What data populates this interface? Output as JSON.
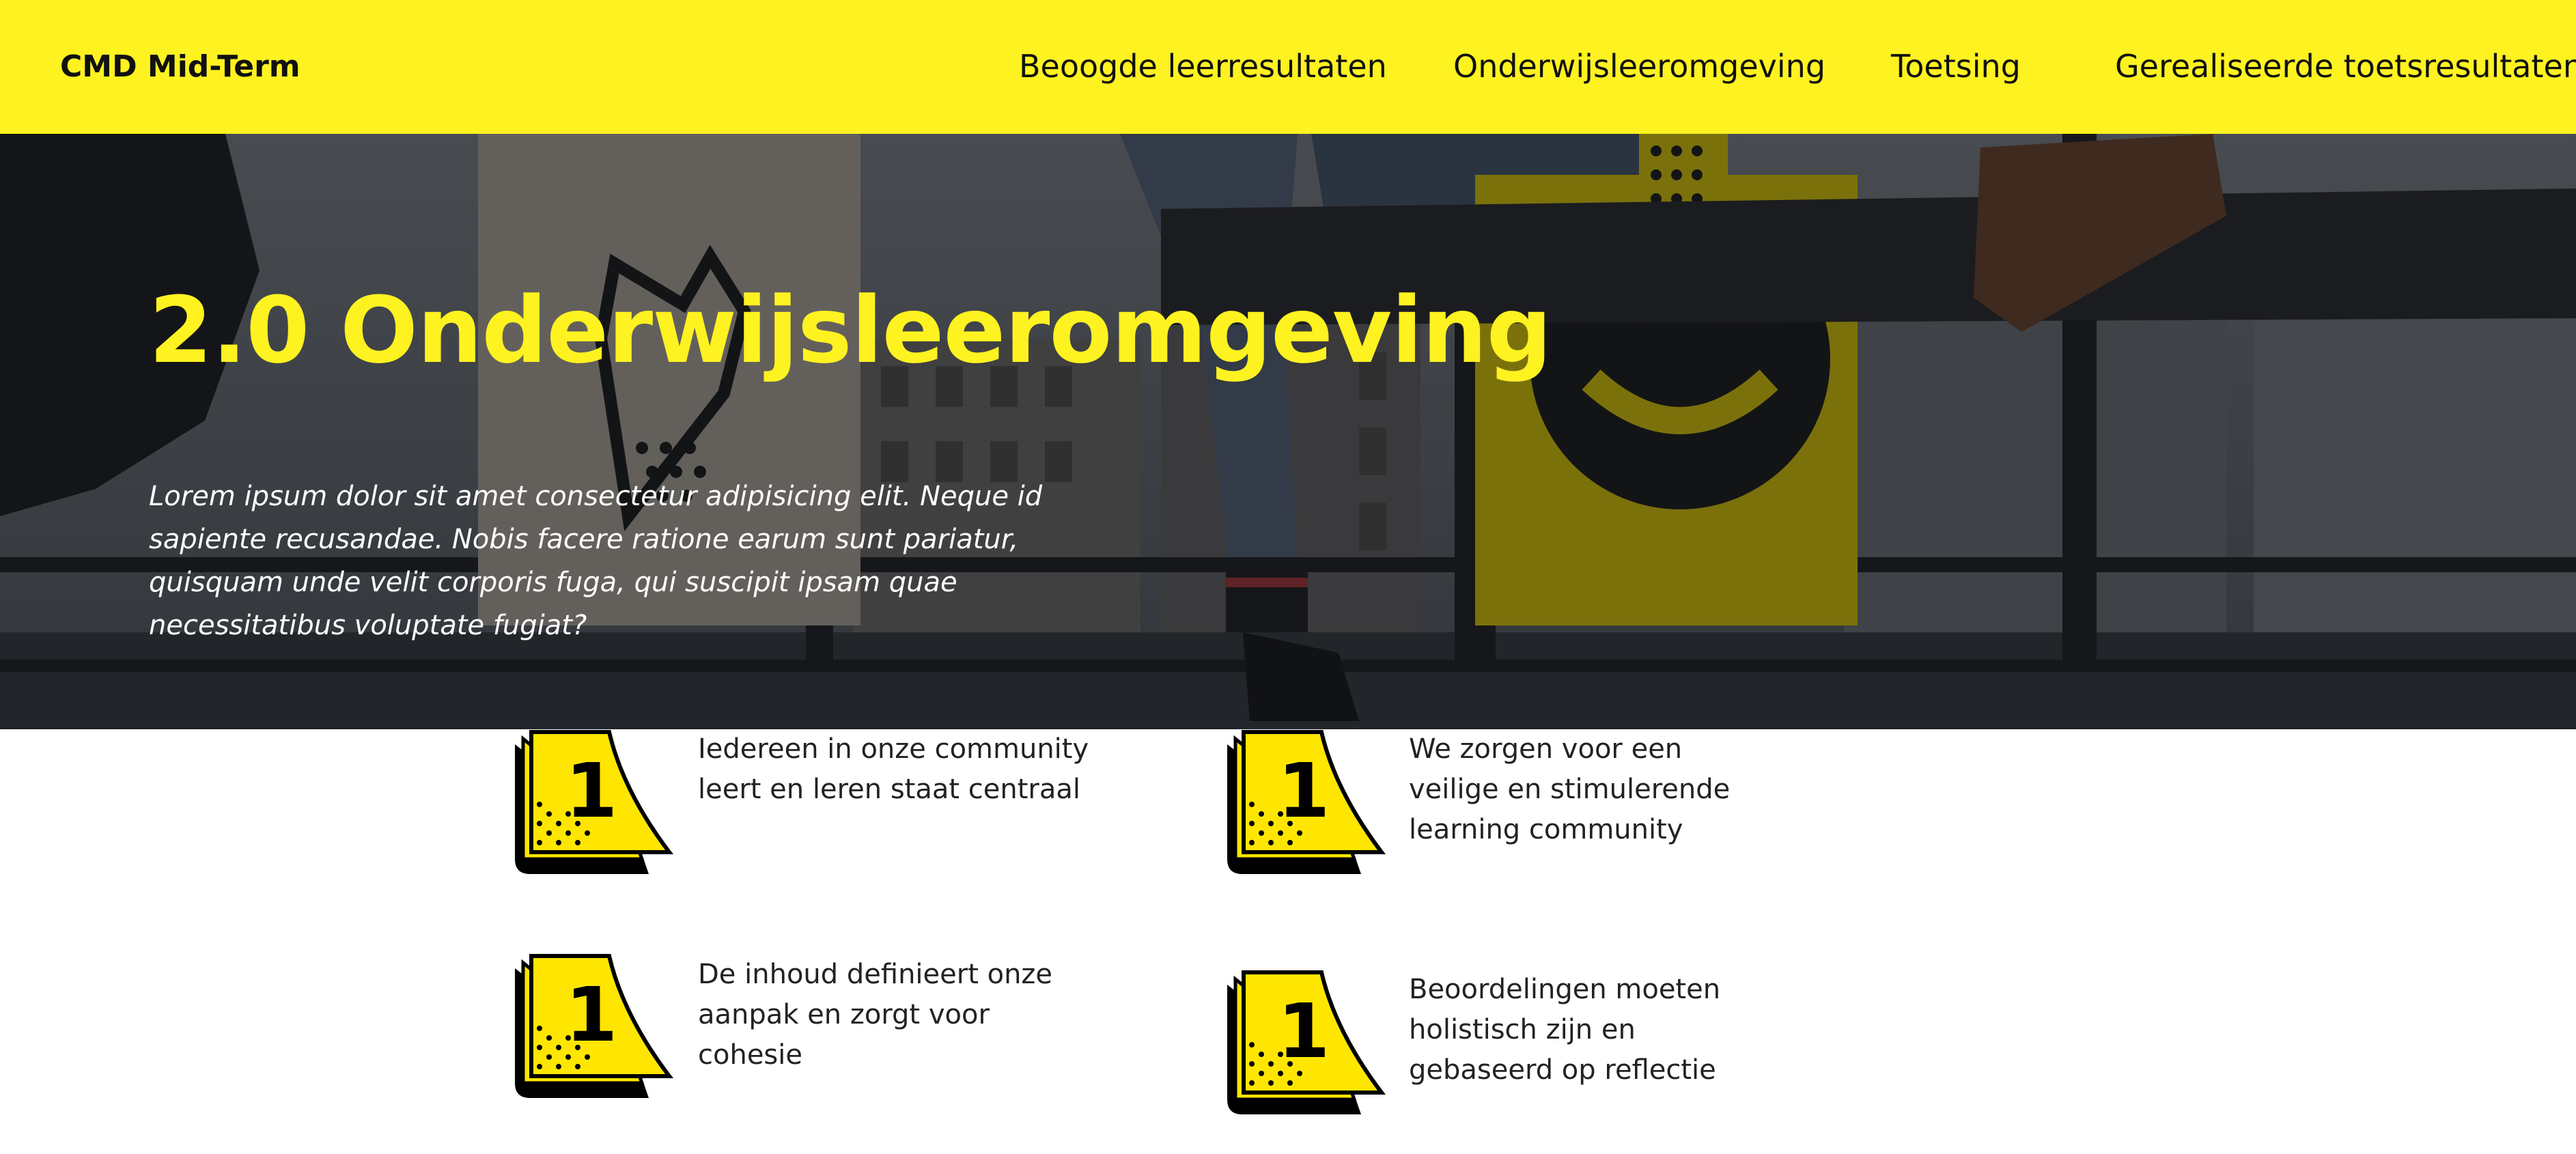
{
  "header": {
    "brand": "CMD Mid-Term",
    "nav": [
      {
        "label": "Beoogde leerresultaten"
      },
      {
        "label": "Onderwijsleeromgeving"
      },
      {
        "label": "Toetsing"
      },
      {
        "label": "Gerealiseerde toetsresultaten"
      }
    ]
  },
  "colors": {
    "accent": "#FFF221",
    "hero_overlay": "#0f1114",
    "text": "#222222"
  },
  "hero": {
    "title": "2.0 Onderwijsleeromgeving",
    "lead": "Lorem ipsum dolor sit amet consectetur adipisicing elit. Neque id sapiente recusandae. Nobis facere ratione earum sunt pariatur, quisquam unde velit corporis fuga, qui suscipit ipsam quae necessitatibus voluptate fugiat?"
  },
  "features": [
    {
      "icon": "sticky-note-number-icon",
      "number": "1",
      "text": "Iedereen in onze community leert en leren staat centraal"
    },
    {
      "icon": "sticky-note-number-icon",
      "number": "1",
      "text": "We zorgen voor een veilige en stimulerende learning community"
    },
    {
      "icon": "sticky-note-number-icon",
      "number": "1",
      "text": "De inhoud definieert onze aanpak en zorgt voor cohesie"
    },
    {
      "icon": "sticky-note-number-icon",
      "number": "1",
      "text": "Beoordelingen moeten holistisch zijn en gebaseerd op reflectie"
    }
  ]
}
